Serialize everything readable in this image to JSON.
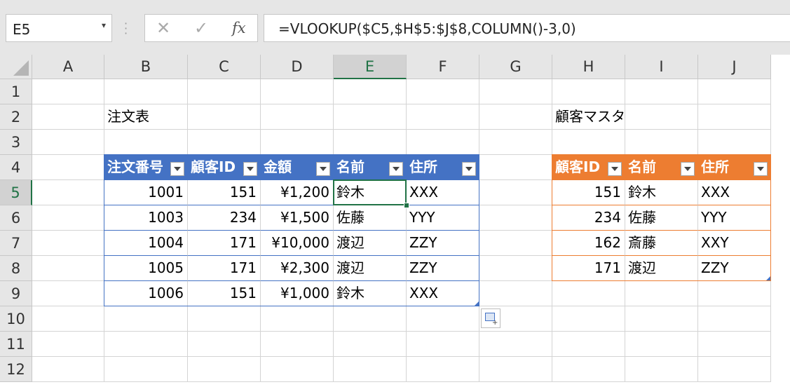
{
  "name_box": {
    "value": "E5"
  },
  "formula_bar": {
    "formula": "=VLOOKUP($C5,$H$5:$J$8,COLUMN()-3,0)",
    "cancel_glyph": "✕",
    "enter_glyph": "✓",
    "fx_label": "fx"
  },
  "columns": [
    "A",
    "B",
    "C",
    "D",
    "E",
    "F",
    "G",
    "H",
    "I",
    "J"
  ],
  "rows": [
    "1",
    "2",
    "3",
    "4",
    "5",
    "6",
    "7",
    "8",
    "9",
    "10",
    "11",
    "12"
  ],
  "titles": {
    "order_table": "注文表",
    "customer_master": "顧客マスタ"
  },
  "order_table": {
    "headers": [
      "注文番号",
      "顧客ID",
      "金額",
      "名前",
      "住所"
    ],
    "rows": [
      [
        "1001",
        "151",
        "¥1,200",
        "鈴木",
        "XXX"
      ],
      [
        "1003",
        "234",
        "¥1,500",
        "佐藤",
        "YYY"
      ],
      [
        "1004",
        "171",
        "¥10,000",
        "渡辺",
        "ZZY"
      ],
      [
        "1005",
        "171",
        "¥2,300",
        "渡辺",
        "ZZY"
      ],
      [
        "1006",
        "151",
        "¥1,000",
        "鈴木",
        "XXX"
      ]
    ]
  },
  "customer_master": {
    "headers": [
      "顧客ID",
      "名前",
      "住所"
    ],
    "rows": [
      [
        "151",
        "鈴木",
        "XXX"
      ],
      [
        "234",
        "佐藤",
        "YYY"
      ],
      [
        "162",
        "斎藤",
        "XXY"
      ],
      [
        "171",
        "渡辺",
        "ZZY"
      ]
    ]
  },
  "colors": {
    "order_header": "#4472c4",
    "master_header": "#ed7d31",
    "selection": "#217346"
  },
  "selected_cell": "E5"
}
